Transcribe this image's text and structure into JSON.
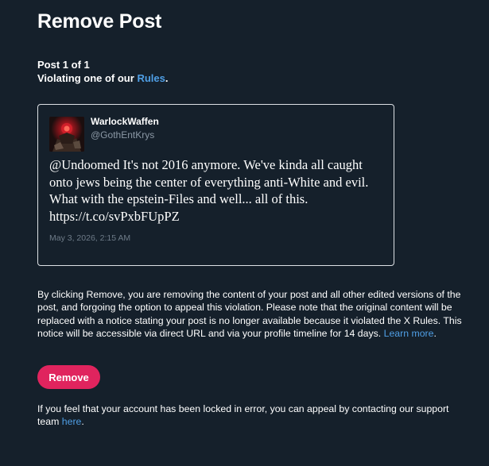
{
  "header": {
    "title": "Remove Post"
  },
  "meta": {
    "post_counter": "Post 1 of 1",
    "violation_prefix": "Violating one of our ",
    "rules_link": "Rules",
    "violation_suffix": "."
  },
  "post": {
    "display_name": "WarlockWaffen",
    "handle": "@GothEntKrys",
    "text": "@Undoomed It's not 2016 anymore. We've kinda all caught onto jews being the center of everything anti-White and evil. What with the epstein-Files and well... all of this. https://t.co/svPxbFUpPZ",
    "timestamp": "May 3, 2026, 2:15 AM",
    "avatar_icon": "profile-avatar-image"
  },
  "notice": {
    "text": "By clicking Remove, you are removing the content of your post and all other edited versions of the post, and forgoing the option to appeal this violation. Please note that the original content will be replaced with a notice stating your post is no longer available because it violated the X Rules. This notice will be accessible via direct URL and via your profile timeline for 14 days. ",
    "learn_more": "Learn more",
    "suffix": "."
  },
  "actions": {
    "remove_label": "Remove"
  },
  "appeal": {
    "text": "If you feel that your account has been locked in error, you can appeal by contacting our support team ",
    "link": "here",
    "suffix": "."
  },
  "colors": {
    "background": "#15202b",
    "link": "#4f9fe6",
    "remove_button": "#e0245e",
    "card_border": "#dde1e5",
    "muted_text": "#8b98a5"
  }
}
